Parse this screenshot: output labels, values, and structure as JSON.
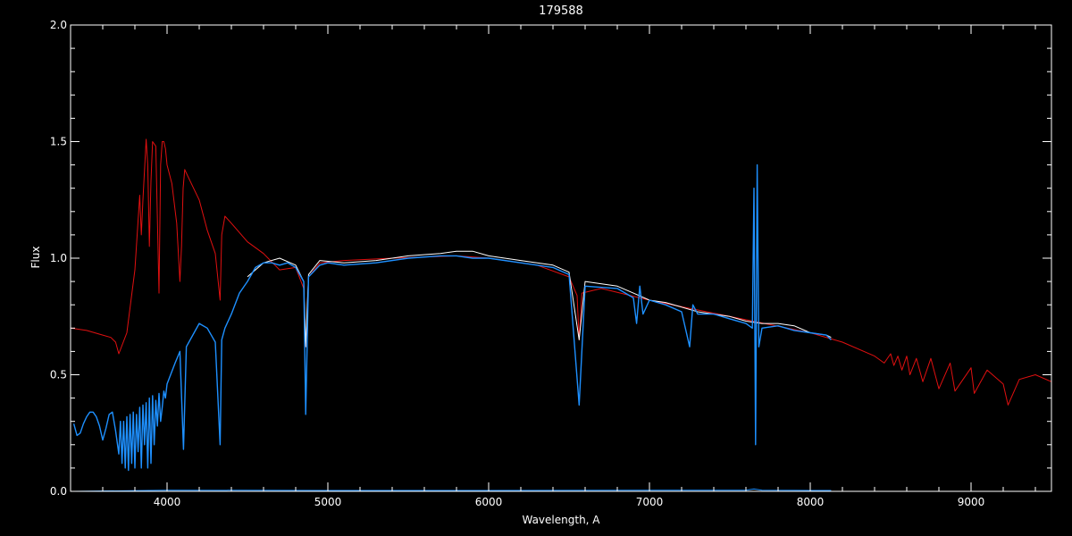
{
  "chart_data": {
    "type": "line",
    "title": "179588",
    "xlabel": "Wavelength, A",
    "ylabel": "Flux",
    "xlim": [
      3400,
      9500
    ],
    "ylim": [
      0,
      2.0
    ],
    "xticks": [
      4000,
      5000,
      6000,
      7000,
      8000,
      9000
    ],
    "xtick_labels": [
      "4000",
      "5000",
      "6000",
      "7000",
      "8000",
      "9000"
    ],
    "yticks": [
      0,
      0.5,
      1.0,
      1.5,
      2.0
    ],
    "ytick_labels": [
      "0.0",
      "0.5",
      "1.0",
      "1.5",
      "2.0"
    ],
    "grid": false,
    "colors": {
      "background": "#000000",
      "axes": "#ffffff",
      "observed_raw": "#ffffff",
      "observed": "#1e90ff",
      "model": "#e01010"
    },
    "series": [
      {
        "color": "#e01010",
        "x": [
          3400,
          3500,
          3600,
          3650,
          3680,
          3700,
          3750,
          3800,
          3830,
          3840,
          3850,
          3870,
          3880,
          3890,
          3900,
          3910,
          3930,
          3950,
          3960,
          3970,
          3980,
          3990,
          4000,
          4030,
          4060,
          4080,
          4090,
          4100,
          4110,
          4130,
          4200,
          4250,
          4300,
          4330,
          4340,
          4360,
          4400,
          4500,
          4600,
          4700,
          4800,
          4850,
          4862,
          4880,
          4950,
          5100,
          5400,
          5800,
          6000,
          6300,
          6500,
          6550,
          6563,
          6580,
          6700,
          7000,
          7500,
          8000,
          8200,
          8400,
          8460,
          8500,
          8520,
          8545,
          8570,
          8600,
          8620,
          8660,
          8700,
          8750,
          8800,
          8870,
          8900,
          9000,
          9020,
          9100,
          9200,
          9230,
          9300,
          9400,
          9500
        ],
        "y": [
          0.7,
          0.69,
          0.67,
          0.66,
          0.64,
          0.59,
          0.68,
          0.95,
          1.27,
          1.1,
          1.25,
          1.51,
          1.4,
          1.05,
          1.33,
          1.5,
          1.48,
          0.85,
          1.4,
          1.5,
          1.5,
          1.47,
          1.4,
          1.32,
          1.15,
          0.9,
          1.05,
          1.3,
          1.38,
          1.35,
          1.25,
          1.12,
          1.02,
          0.82,
          1.1,
          1.18,
          1.15,
          1.07,
          1.02,
          0.95,
          0.96,
          0.87,
          0.62,
          0.92,
          0.98,
          0.99,
          1.0,
          1.01,
          1.0,
          0.97,
          0.92,
          0.84,
          0.65,
          0.85,
          0.87,
          0.82,
          0.75,
          0.68,
          0.64,
          0.58,
          0.55,
          0.59,
          0.54,
          0.58,
          0.52,
          0.58,
          0.5,
          0.57,
          0.47,
          0.57,
          0.44,
          0.55,
          0.43,
          0.53,
          0.42,
          0.52,
          0.46,
          0.37,
          0.48,
          0.5,
          0.47
        ]
      },
      {
        "color": "#ffffff",
        "x": [
          4500,
          4600,
          4700,
          4800,
          4850,
          4862,
          4880,
          4950,
          5100,
          5300,
          5500,
          5700,
          5800,
          5900,
          6000,
          6200,
          6400,
          6500,
          6563,
          6600,
          6800,
          6900,
          7000,
          7100,
          7200,
          7300,
          7400,
          7500,
          7600,
          7700,
          7800,
          7900,
          8000,
          8100,
          8130
        ],
        "y": [
          0.92,
          0.98,
          1.0,
          0.97,
          0.9,
          0.62,
          0.93,
          0.99,
          0.98,
          0.99,
          1.01,
          1.02,
          1.03,
          1.03,
          1.01,
          0.99,
          0.97,
          0.94,
          0.65,
          0.9,
          0.88,
          0.85,
          0.82,
          0.81,
          0.79,
          0.77,
          0.76,
          0.75,
          0.73,
          0.72,
          0.72,
          0.71,
          0.68,
          0.67,
          0.66
        ]
      },
      {
        "color": "#1e90ff",
        "x": [
          3420,
          3440,
          3460,
          3480,
          3500,
          3520,
          3540,
          3560,
          3580,
          3600,
          3620,
          3640,
          3660,
          3680,
          3700,
          3710,
          3720,
          3730,
          3740,
          3750,
          3760,
          3770,
          3780,
          3790,
          3800,
          3810,
          3820,
          3830,
          3840,
          3850,
          3860,
          3870,
          3880,
          3890,
          3900,
          3910,
          3920,
          3930,
          3940,
          3950,
          3960,
          3970,
          3980,
          3990,
          4000,
          4050,
          4080,
          4102,
          4120,
          4200,
          4250,
          4300,
          4330,
          4340,
          4360,
          4400,
          4450,
          4500,
          4550,
          4600,
          4650,
          4700,
          4750,
          4800,
          4850,
          4862,
          4880,
          4950,
          5000,
          5100,
          5300,
          5500,
          5700,
          5800,
          5900,
          6000,
          6200,
          6400,
          6500,
          6563,
          6600,
          6800,
          6900,
          6920,
          6940,
          6960,
          7000,
          7100,
          7200,
          7250,
          7270,
          7300,
          7400,
          7500,
          7600,
          7640,
          7650,
          7660,
          7670,
          7680,
          7700,
          7800,
          7900,
          8000,
          8100,
          8130
        ],
        "y": [
          0.29,
          0.24,
          0.25,
          0.29,
          0.32,
          0.34,
          0.34,
          0.32,
          0.28,
          0.22,
          0.27,
          0.33,
          0.34,
          0.26,
          0.16,
          0.3,
          0.12,
          0.3,
          0.1,
          0.32,
          0.09,
          0.33,
          0.12,
          0.34,
          0.1,
          0.33,
          0.17,
          0.36,
          0.1,
          0.37,
          0.2,
          0.38,
          0.1,
          0.4,
          0.12,
          0.41,
          0.2,
          0.39,
          0.28,
          0.42,
          0.3,
          0.36,
          0.43,
          0.4,
          0.46,
          0.55,
          0.6,
          0.18,
          0.62,
          0.72,
          0.7,
          0.64,
          0.2,
          0.65,
          0.7,
          0.76,
          0.85,
          0.9,
          0.96,
          0.98,
          0.98,
          0.97,
          0.98,
          0.96,
          0.9,
          0.33,
          0.92,
          0.97,
          0.98,
          0.97,
          0.98,
          1.0,
          1.01,
          1.01,
          1.0,
          1.0,
          0.98,
          0.96,
          0.93,
          0.37,
          0.88,
          0.87,
          0.83,
          0.72,
          0.88,
          0.76,
          0.82,
          0.8,
          0.77,
          0.62,
          0.8,
          0.76,
          0.76,
          0.74,
          0.72,
          0.7,
          1.3,
          0.2,
          1.4,
          0.62,
          0.7,
          0.71,
          0.69,
          0.68,
          0.67,
          0.65
        ]
      },
      {
        "color": "#1e90ff",
        "x": [
          3420,
          4000,
          5000,
          6000,
          7000,
          7600,
          7650,
          7700,
          8000,
          8130
        ],
        "y": [
          0.0,
          0.005,
          0.004,
          0.004,
          0.005,
          0.005,
          0.01,
          0.005,
          0.004,
          0.004
        ]
      }
    ]
  }
}
